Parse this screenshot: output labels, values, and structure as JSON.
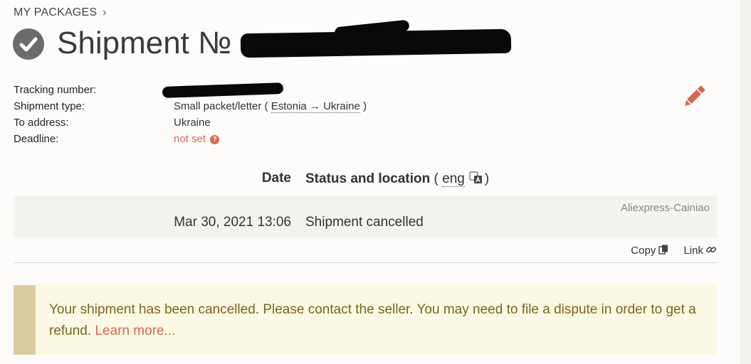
{
  "breadcrumb": {
    "label": "MY PACKAGES",
    "chevron": "›"
  },
  "header": {
    "title": "Shipment №"
  },
  "meta": {
    "tracking_label": "Tracking number:",
    "type_label": "Shipment type:",
    "type_value": "Small packet/letter",
    "route": "Estonia → Ukraine",
    "address_label": "To address:",
    "address_value": "Ukraine",
    "deadline_label": "Deadline:",
    "deadline_value": "not set"
  },
  "table": {
    "col_date": "Date",
    "col_status": "Status and location",
    "lang": "eng"
  },
  "events": [
    {
      "carrier": "Aliexpress-Cainiao",
      "date": "Mar 30, 2021 13:06",
      "status": "Shipment cancelled"
    }
  ],
  "actions": {
    "copy_label": "Copy",
    "link_label": "Link"
  },
  "alert": {
    "text": "Your shipment has been cancelled. Please contact the seller. You may need to file a dispute in order to get a refund.",
    "link": "Learn more..."
  },
  "colors": {
    "accent": "#d46a55",
    "alert_bg": "#fbf8e3",
    "alert_bar": "#dbcca0",
    "alert_text": "#7a6424"
  },
  "icons": [
    "check-circle-icon",
    "pencil-icon",
    "question-icon",
    "translate-icon",
    "copy-icon",
    "link-icon"
  ]
}
